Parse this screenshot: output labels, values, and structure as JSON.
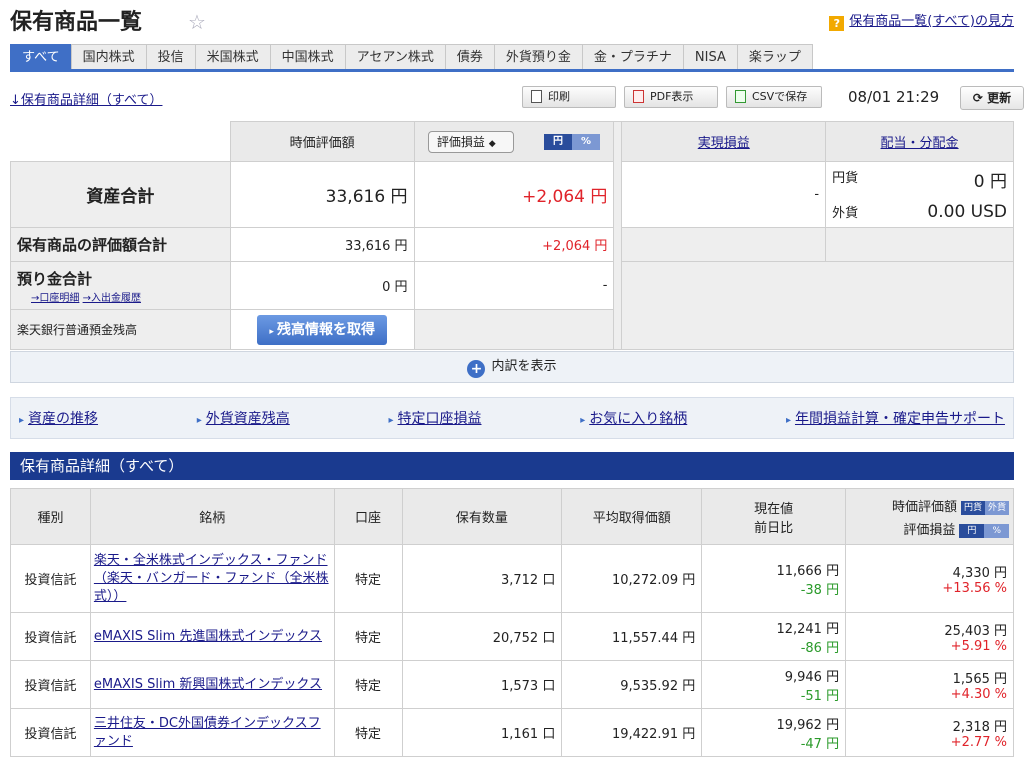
{
  "header": {
    "title": "保有商品一覧",
    "help_badge": "?",
    "help_link": "保有商品一覧(すべて)の見方"
  },
  "tabs": [
    "すべて",
    "国内株式",
    "投信",
    "米国株式",
    "中国株式",
    "アセアン株式",
    "債券",
    "外貨預り金",
    "金・プラチナ",
    "NISA",
    "楽ラップ"
  ],
  "toolbar": {
    "detail_link": "↓保有商品詳細（すべて）",
    "print": "印刷",
    "pdf": "PDF表示",
    "csv": "CSVで保存",
    "datetime": "08/01 21:29",
    "refresh": "更新"
  },
  "summary": {
    "col_market_value": "時価評価額",
    "select_value": "評価損益",
    "toggle_yen": "円",
    "toggle_pct": "%",
    "col_realized": "実現損益",
    "col_dividend": "配当・分配金",
    "total_label": "資産合計",
    "total_value": "33,616 円",
    "total_pl": "+2,064 円",
    "realized": "-",
    "div_jpy_label": "円貨",
    "div_jpy": "0 円",
    "div_fx_label": "外貨",
    "div_fx": "0.00 USD",
    "holdings_label": "保有商品の評価額合計",
    "holdings_value": "33,616 円",
    "holdings_pl": "+2,064 円",
    "deposit_label": "預り金合計",
    "deposit_link1": "→口座明細",
    "deposit_link2": "→入出金履歴",
    "deposit_value": "0 円",
    "deposit_pl": "-",
    "bank_label": "楽天銀行普通預金残高",
    "bank_button": "残高情報を取得",
    "show_breakdown": "内訳を表示"
  },
  "quicklinks": [
    "資産の推移",
    "外貨資産残高",
    "特定口座損益",
    "お気に入り銘柄",
    "年間損益計算・確定申告サポート"
  ],
  "section_title": "保有商品詳細（すべて）",
  "holdings": {
    "headers": {
      "type": "種別",
      "name": "銘柄",
      "account": "口座",
      "qty": "保有数量",
      "avg": "平均取得価額",
      "price": "現在値",
      "change": "前日比",
      "mv": "時価評価額",
      "mv_t1": "円貨",
      "mv_t2": "外貨",
      "pl": "評価損益",
      "pl_t1": "円",
      "pl_t2": "%"
    },
    "rows": [
      {
        "type": "投資信託",
        "name": "楽天・全米株式インデックス・ファンド（楽天・バンガード・ファンド（全米株式））",
        "account": "特定",
        "qty": "3,712 口",
        "avg": "10,272.09 円",
        "price": "11,666 円",
        "change": "-38 円",
        "mv": "4,330 円",
        "pl": "+13.56 %"
      },
      {
        "type": "投資信託",
        "name": "eMAXIS Slim 先進国株式インデックス",
        "account": "特定",
        "qty": "20,752 口",
        "avg": "11,557.44 円",
        "price": "12,241 円",
        "change": "-86 円",
        "mv": "25,403 円",
        "pl": "+5.91 %"
      },
      {
        "type": "投資信託",
        "name": "eMAXIS Slim 新興国株式インデックス",
        "account": "特定",
        "qty": "1,573 口",
        "avg": "9,535.92 円",
        "price": "9,946 円",
        "change": "-51 円",
        "mv": "1,565 円",
        "pl": "+4.30 %"
      },
      {
        "type": "投資信託",
        "name": "三井住友・DC外国債券インデックスファンド",
        "account": "特定",
        "qty": "1,161 口",
        "avg": "19,422.91 円",
        "price": "19,962 円",
        "change": "-47 円",
        "mv": "2,318 円",
        "pl": "+2.77 %"
      }
    ]
  },
  "colors": {
    "accent": "#3f6fc6",
    "section": "#1a3a8f",
    "positive": "#e0232a",
    "negative": "#2a9a2a"
  }
}
